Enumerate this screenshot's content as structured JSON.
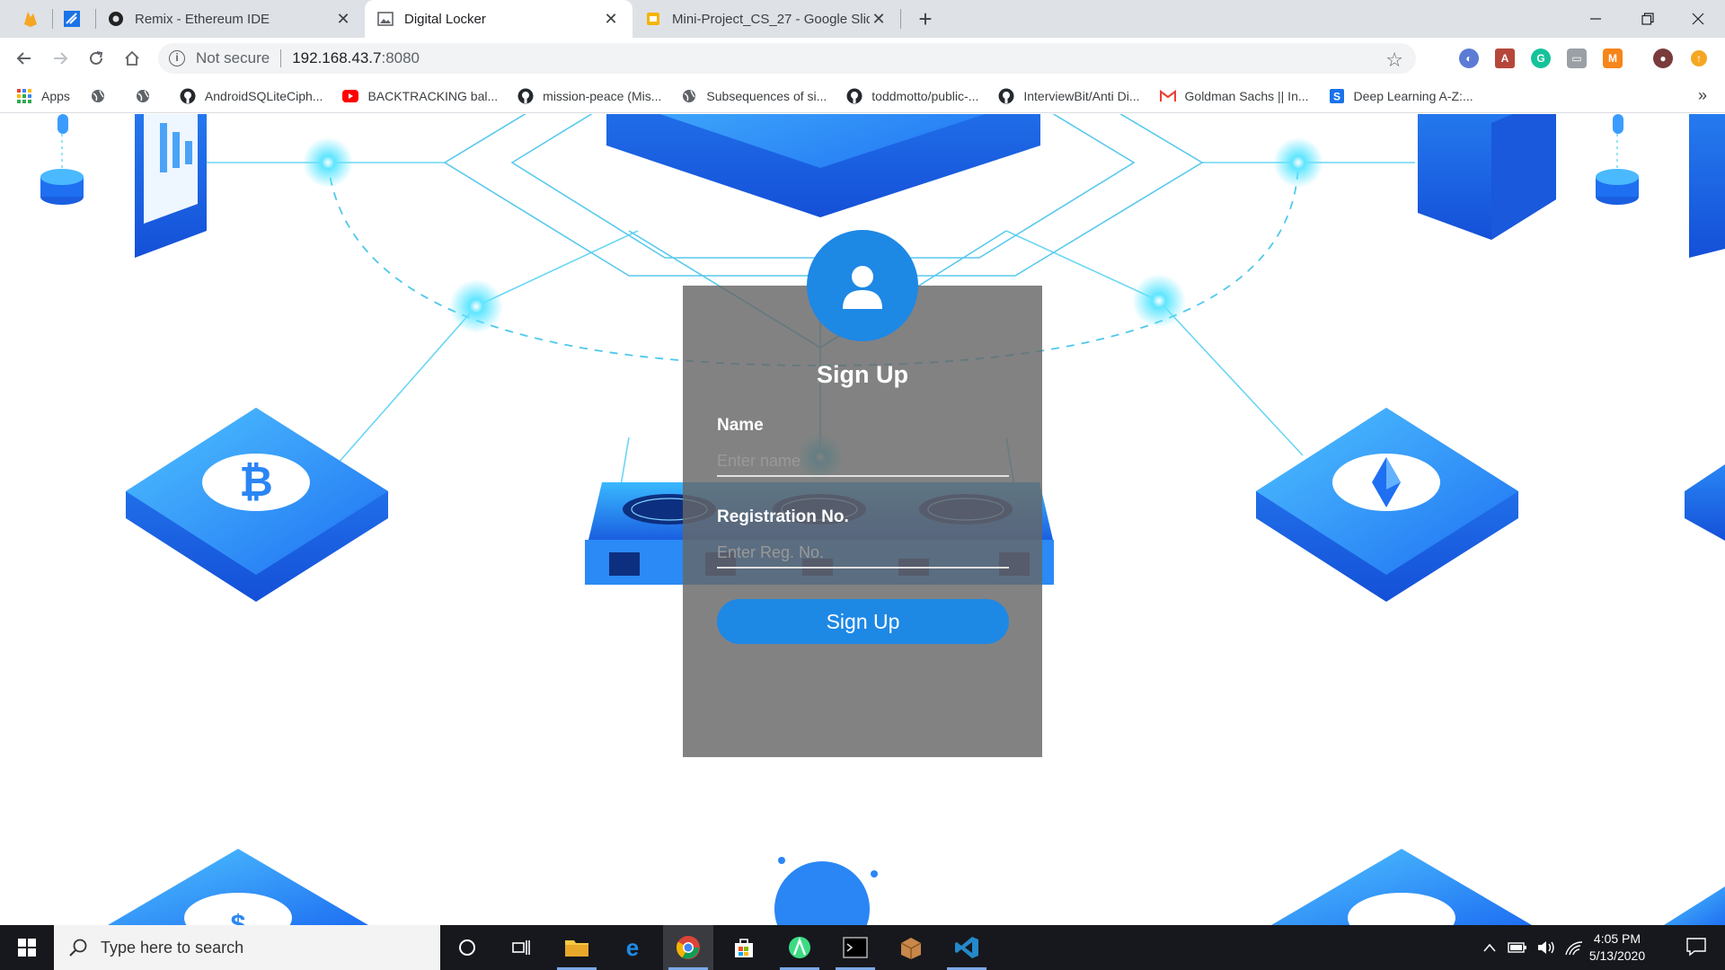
{
  "browser": {
    "tabs": [
      {
        "title": "Remix - Ethereum IDE",
        "active": false
      },
      {
        "title": "Digital Locker",
        "active": true
      },
      {
        "title": "Mini-Project_CS_27 - Google Slid",
        "active": false
      }
    ],
    "address": {
      "security_label": "Not secure",
      "url_host": "192.168.43.7",
      "url_port": ":8080"
    },
    "bookmarks": [
      {
        "label": "Apps",
        "icon": "apps-grid-icon"
      },
      {
        "label": "",
        "icon": "globe-icon"
      },
      {
        "label": "",
        "icon": "globe-icon"
      },
      {
        "label": "AndroidSQLiteCiph...",
        "icon": "github-icon"
      },
      {
        "label": "BACKTRACKING bal...",
        "icon": "youtube-icon"
      },
      {
        "label": "mission-peace (Mis...",
        "icon": "github-icon"
      },
      {
        "label": "Subsequences of si...",
        "icon": "globe-icon"
      },
      {
        "label": "toddmotto/public-...",
        "icon": "github-icon"
      },
      {
        "label": "InterviewBit/Anti Di...",
        "icon": "github-icon"
      },
      {
        "label": "Goldman Sachs || In...",
        "icon": "gmail-icon"
      },
      {
        "label": "Deep Learning A-Z:...",
        "icon": "s-icon"
      }
    ],
    "bookmarks_overflow": "»"
  },
  "signup": {
    "title": "Sign Up",
    "name_label": "Name",
    "name_placeholder": "Enter name",
    "reg_label": "Registration No.",
    "reg_placeholder": "Enter Reg. No.",
    "button_label": "Sign Up"
  },
  "taskbar": {
    "search_placeholder": "Type here to search",
    "time": "4:05 PM",
    "date": "5/13/2020"
  },
  "colors": {
    "accent": "#1e88e5",
    "card": "#666666",
    "taskbar": "#17181d"
  }
}
